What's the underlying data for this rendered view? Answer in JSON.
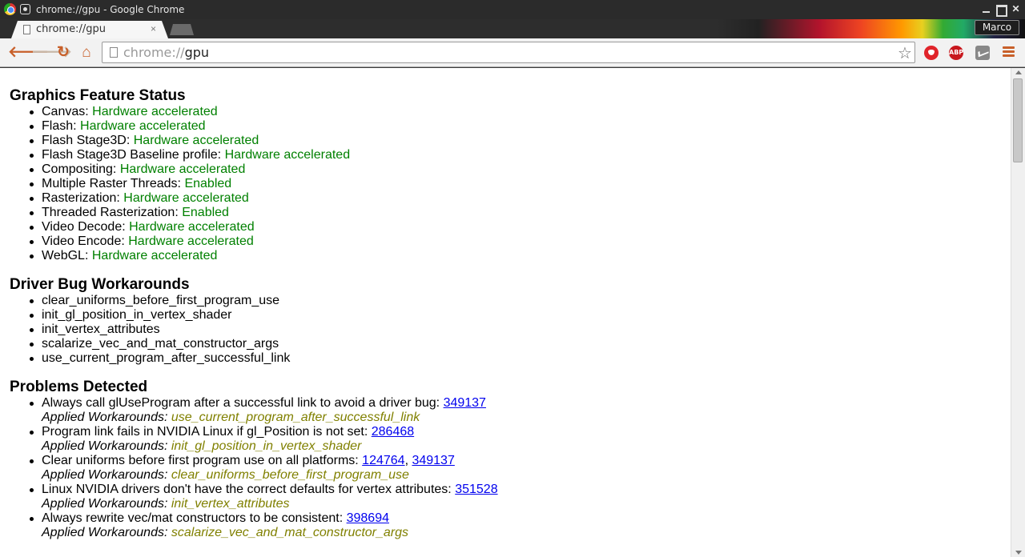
{
  "window": {
    "title": "chrome://gpu - Google Chrome"
  },
  "tab": {
    "label": "chrome://gpu",
    "close_glyph": "×"
  },
  "profile": {
    "name": "Marco"
  },
  "toolbar": {
    "back_glyph": "🡐",
    "forward_glyph": "🡒",
    "reload_glyph": "↻",
    "home_glyph": "⌂",
    "url_scheme": "chrome://",
    "url_host": "gpu",
    "star_glyph": "☆",
    "abp_label": "ABP"
  },
  "features": {
    "title": "Graphics Feature Status",
    "items": [
      {
        "name": "Canvas:",
        "status": "Hardware accelerated"
      },
      {
        "name": "Flash:",
        "status": "Hardware accelerated"
      },
      {
        "name": "Flash Stage3D:",
        "status": "Hardware accelerated"
      },
      {
        "name": "Flash Stage3D Baseline profile:",
        "status": "Hardware accelerated"
      },
      {
        "name": "Compositing:",
        "status": "Hardware accelerated"
      },
      {
        "name": "Multiple Raster Threads:",
        "status": "Enabled"
      },
      {
        "name": "Rasterization:",
        "status": "Hardware accelerated"
      },
      {
        "name": "Threaded Rasterization:",
        "status": "Enabled"
      },
      {
        "name": "Video Decode:",
        "status": "Hardware accelerated"
      },
      {
        "name": "Video Encode:",
        "status": "Hardware accelerated"
      },
      {
        "name": "WebGL:",
        "status": "Hardware accelerated"
      }
    ]
  },
  "workarounds": {
    "title": "Driver Bug Workarounds",
    "items": [
      "clear_uniforms_before_first_program_use",
      "init_gl_position_in_vertex_shader",
      "init_vertex_attributes",
      "scalarize_vec_and_mat_constructor_args",
      "use_current_program_after_successful_link"
    ]
  },
  "problems": {
    "title": "Problems Detected",
    "applied_label": "Applied Workarounds:",
    "items": [
      {
        "text": "Always call glUseProgram after a successful link to avoid a driver bug:",
        "bugs": [
          "349137"
        ],
        "workaround": "use_current_program_after_successful_link"
      },
      {
        "text": "Program link fails in NVIDIA Linux if gl_Position is not set:",
        "bugs": [
          "286468"
        ],
        "workaround": "init_gl_position_in_vertex_shader"
      },
      {
        "text": "Clear uniforms before first program use on all platforms:",
        "bugs": [
          "124764",
          "349137"
        ],
        "workaround": "clear_uniforms_before_first_program_use"
      },
      {
        "text": "Linux NVIDIA drivers don't have the correct defaults for vertex attributes:",
        "bugs": [
          "351528"
        ],
        "workaround": "init_vertex_attributes"
      },
      {
        "text": "Always rewrite vec/mat constructors to be consistent:",
        "bugs": [
          "398694"
        ],
        "workaround": "scalarize_vec_and_mat_constructor_args"
      }
    ]
  }
}
